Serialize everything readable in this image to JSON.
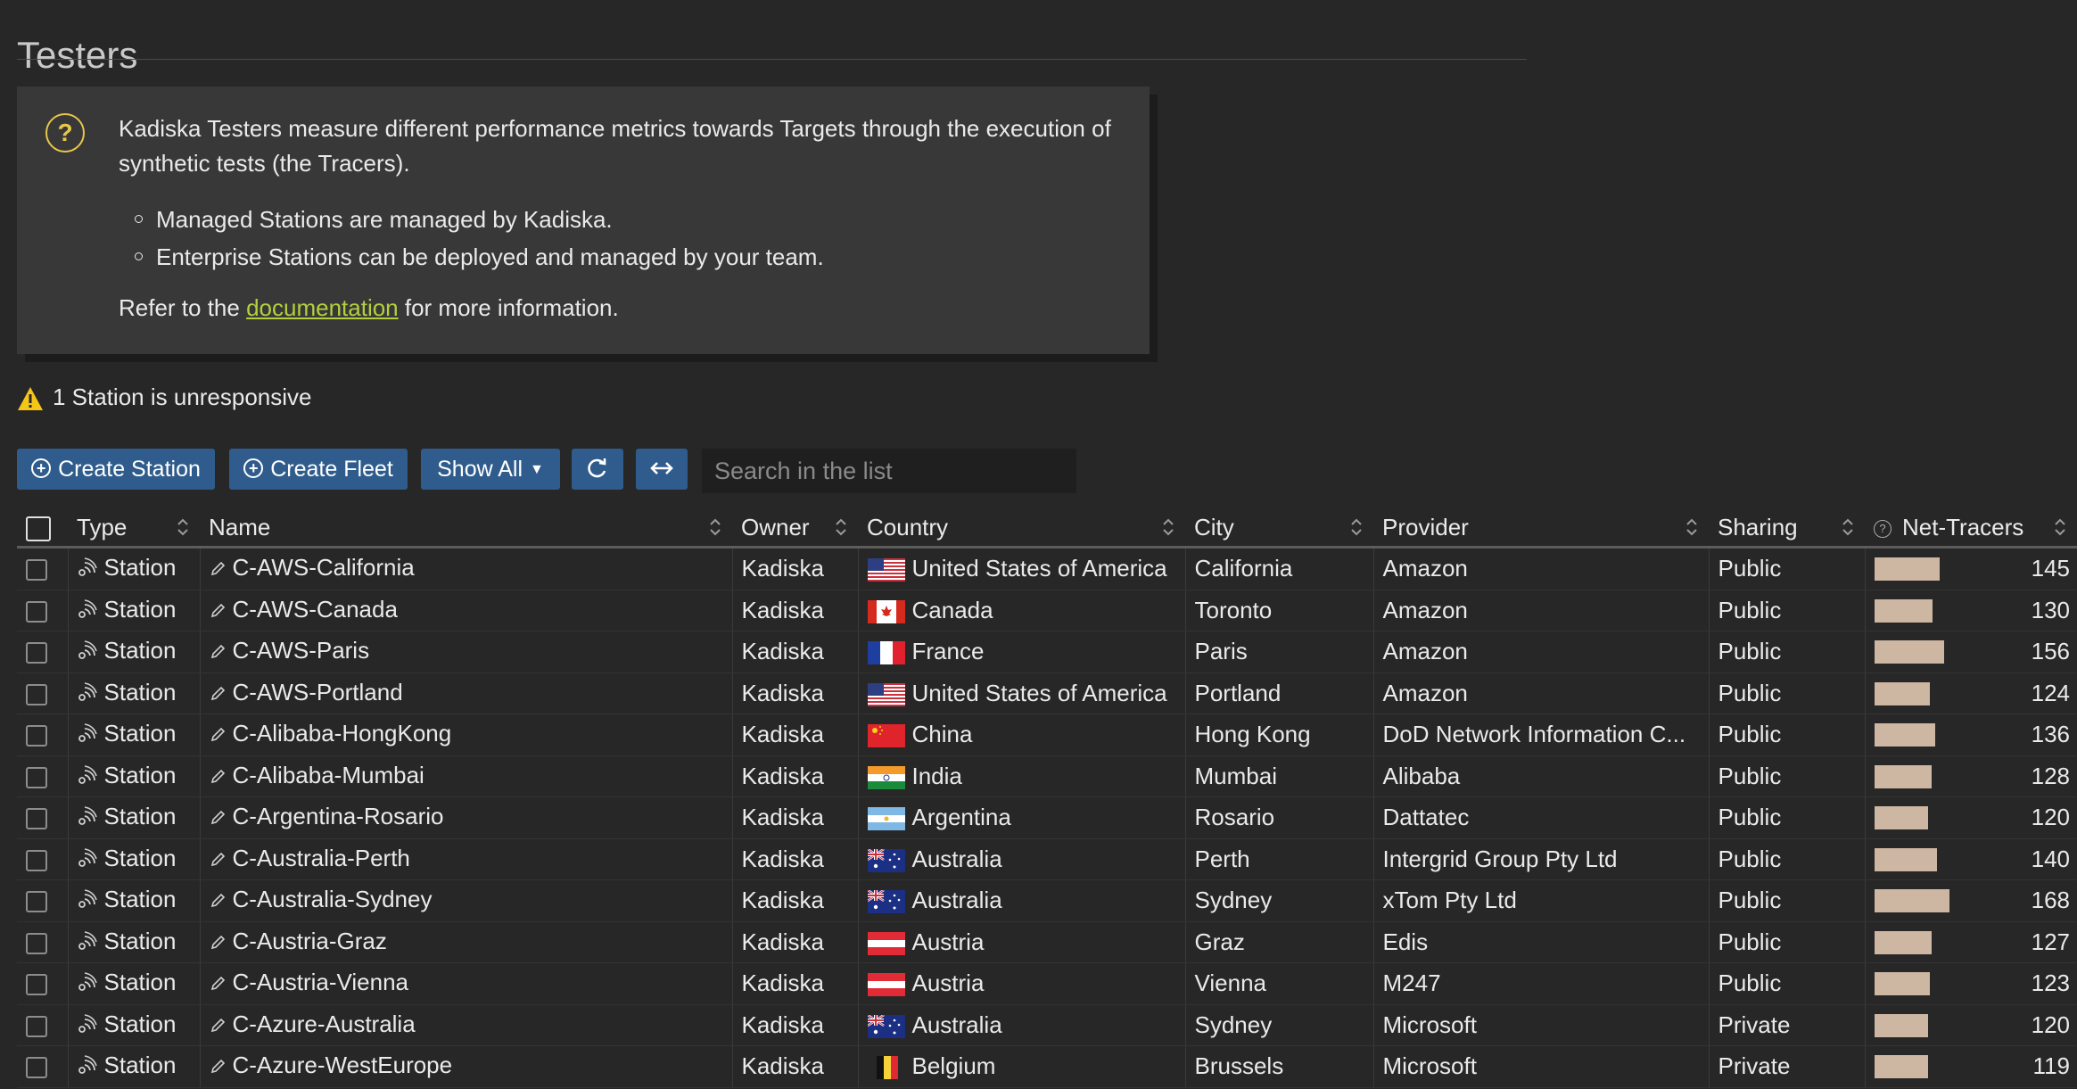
{
  "page": {
    "title": "Testers"
  },
  "info": {
    "intro": "Kadiska Testers measure different performance metrics towards Targets through the execution of synthetic tests (the Tracers).",
    "bullets": [
      "Managed Stations are managed by Kadiska.",
      "Enterprise Stations can be deployed and managed by your team."
    ],
    "refer_prefix": "Refer to the ",
    "refer_link": "documentation",
    "refer_suffix": " for more information."
  },
  "warning": {
    "text": "1 Station is unresponsive"
  },
  "toolbar": {
    "create_station": "Create Station",
    "create_fleet": "Create Fleet",
    "show_all": "Show All",
    "search_placeholder": "Search in the list"
  },
  "colors": {
    "accent": "#2f5c8c",
    "warning": "#f5c518",
    "link": "#b4cf3c",
    "bar": "#cdb6a2"
  },
  "table": {
    "columns": [
      "Type",
      "Name",
      "Owner",
      "Country",
      "City",
      "Provider",
      "Sharing",
      "Net-Tracers"
    ],
    "max_value": 168,
    "rows": [
      {
        "type": "Station",
        "name": "C-AWS-California",
        "owner": "Kadiska",
        "country": "United States of America",
        "flag": "us",
        "city": "California",
        "provider": "Amazon",
        "sharing": "Public",
        "tracers": 145
      },
      {
        "type": "Station",
        "name": "C-AWS-Canada",
        "owner": "Kadiska",
        "country": "Canada",
        "flag": "ca",
        "city": "Toronto",
        "provider": "Amazon",
        "sharing": "Public",
        "tracers": 130
      },
      {
        "type": "Station",
        "name": "C-AWS-Paris",
        "owner": "Kadiska",
        "country": "France",
        "flag": "fr",
        "city": "Paris",
        "provider": "Amazon",
        "sharing": "Public",
        "tracers": 156
      },
      {
        "type": "Station",
        "name": "C-AWS-Portland",
        "owner": "Kadiska",
        "country": "United States of America",
        "flag": "us",
        "city": "Portland",
        "provider": "Amazon",
        "sharing": "Public",
        "tracers": 124
      },
      {
        "type": "Station",
        "name": "C-Alibaba-HongKong",
        "owner": "Kadiska",
        "country": "China",
        "flag": "cn",
        "city": "Hong Kong",
        "provider": "DoD Network Information C...",
        "sharing": "Public",
        "tracers": 136
      },
      {
        "type": "Station",
        "name": "C-Alibaba-Mumbai",
        "owner": "Kadiska",
        "country": "India",
        "flag": "in",
        "city": "Mumbai",
        "provider": "Alibaba",
        "sharing": "Public",
        "tracers": 128
      },
      {
        "type": "Station",
        "name": "C-Argentina-Rosario",
        "owner": "Kadiska",
        "country": "Argentina",
        "flag": "ar",
        "city": "Rosario",
        "provider": "Dattatec",
        "sharing": "Public",
        "tracers": 120
      },
      {
        "type": "Station",
        "name": "C-Australia-Perth",
        "owner": "Kadiska",
        "country": "Australia",
        "flag": "au",
        "city": "Perth",
        "provider": "Intergrid Group Pty Ltd",
        "sharing": "Public",
        "tracers": 140
      },
      {
        "type": "Station",
        "name": "C-Australia-Sydney",
        "owner": "Kadiska",
        "country": "Australia",
        "flag": "au",
        "city": "Sydney",
        "provider": "xTom Pty Ltd",
        "sharing": "Public",
        "tracers": 168
      },
      {
        "type": "Station",
        "name": "C-Austria-Graz",
        "owner": "Kadiska",
        "country": "Austria",
        "flag": "at",
        "city": "Graz",
        "provider": "Edis",
        "sharing": "Public",
        "tracers": 127
      },
      {
        "type": "Station",
        "name": "C-Austria-Vienna",
        "owner": "Kadiska",
        "country": "Austria",
        "flag": "at",
        "city": "Vienna",
        "provider": "M247",
        "sharing": "Public",
        "tracers": 123
      },
      {
        "type": "Station",
        "name": "C-Azure-Australia",
        "owner": "Kadiska",
        "country": "Australia",
        "flag": "au",
        "city": "Sydney",
        "provider": "Microsoft",
        "sharing": "Private",
        "tracers": 120
      },
      {
        "type": "Station",
        "name": "C-Azure-WestEurope",
        "owner": "Kadiska",
        "country": "Belgium",
        "flag": "be",
        "city": "Brussels",
        "provider": "Microsoft",
        "sharing": "Private",
        "tracers": 119
      }
    ]
  }
}
